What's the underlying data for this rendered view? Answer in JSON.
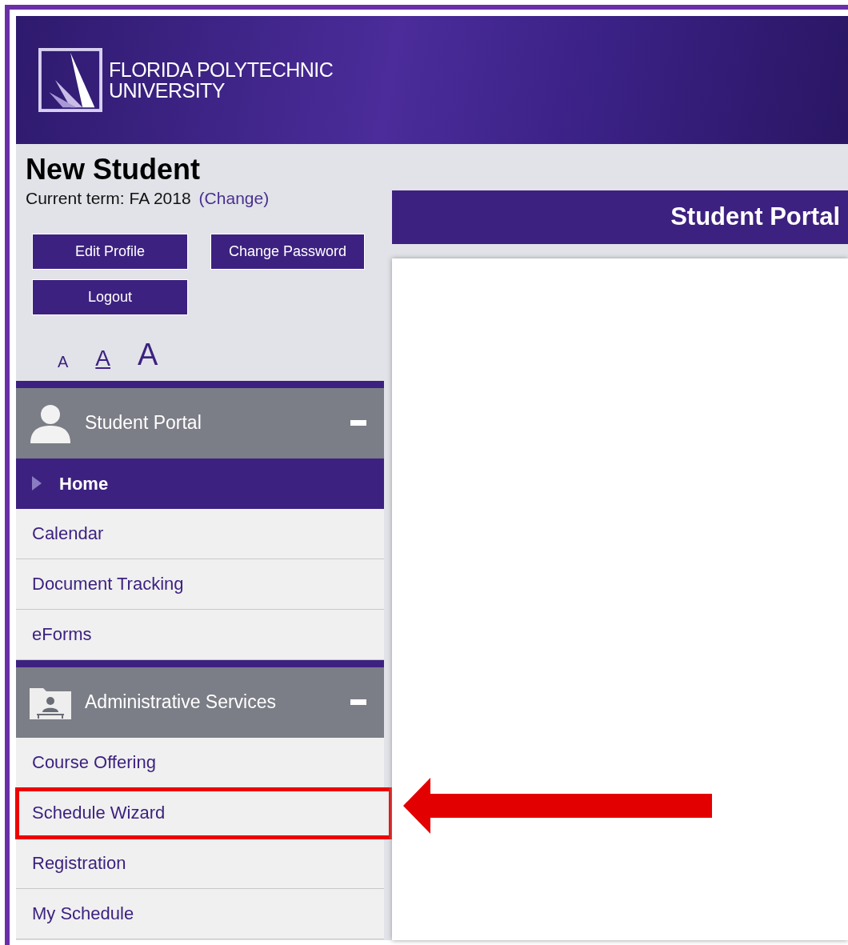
{
  "header": {
    "logo_lines": [
      "FLORIDA POLYTECHNIC",
      "UNIVERSITY"
    ]
  },
  "user": {
    "name": "New Student",
    "term_label": "Current term: FA 2018",
    "change_link": "(Change)"
  },
  "buttons": [
    "Edit Profile",
    "Change Password",
    "Logout"
  ],
  "font_sizes": [
    {
      "label": "A",
      "kind": "small",
      "selected": false
    },
    {
      "label": "A",
      "kind": "medium",
      "selected": true
    },
    {
      "label": "A",
      "kind": "large",
      "selected": false
    }
  ],
  "nav_groups": [
    {
      "title": "Student Portal",
      "kind": "person",
      "expanded": true,
      "items": [
        {
          "label": "Home",
          "selected": true,
          "highlighted": false
        },
        {
          "label": "Calendar",
          "selected": false,
          "highlighted": false
        },
        {
          "label": "Document Tracking",
          "selected": false,
          "highlighted": false
        },
        {
          "label": "eForms",
          "selected": false,
          "highlighted": false
        }
      ]
    },
    {
      "title": "Administrative Services",
      "kind": "folder",
      "expanded": true,
      "items": [
        {
          "label": "Course Offering",
          "selected": false,
          "highlighted": false
        },
        {
          "label": "Schedule Wizard",
          "selected": false,
          "highlighted": true
        },
        {
          "label": "Registration",
          "selected": false,
          "highlighted": false
        },
        {
          "label": "My Schedule",
          "selected": false,
          "highlighted": false
        }
      ]
    }
  ],
  "main_panel": {
    "title": "Student Portal"
  }
}
